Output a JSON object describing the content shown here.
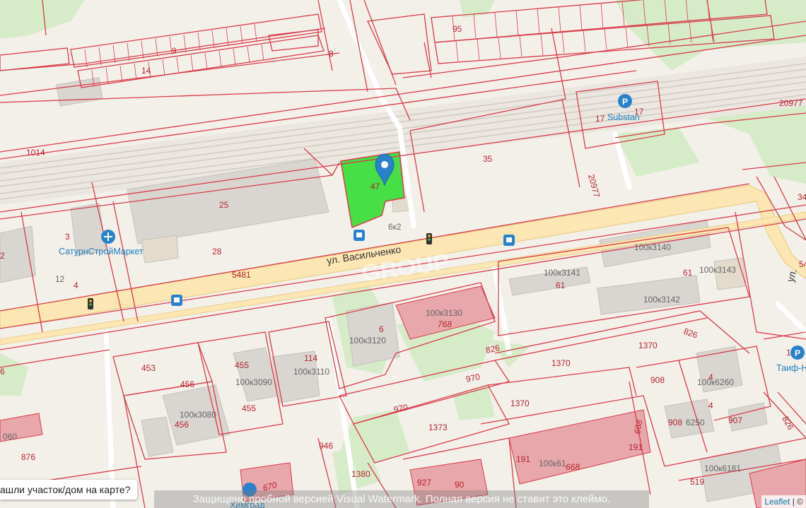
{
  "cadastral_numbers": {
    "n9": "9",
    "n14": "14",
    "n8": "8",
    "n95": "95",
    "n1014": "1014",
    "n20977": "20977",
    "n20977v": "20977",
    "n17a": "17",
    "n17b": "17",
    "n35": "35",
    "n47": "47",
    "n6k2": "6к2",
    "n25": "25",
    "n28": "28",
    "n3": "3",
    "n2": "2",
    "n12": "12",
    "n4": "4",
    "n5481": "5481",
    "n6": "6",
    "n768": "768",
    "n61a": "61",
    "n61b": "61",
    "n826a": "826",
    "n826b": "826",
    "n1370a": "1370",
    "n1370b": "1370",
    "n1370c": "1370",
    "n114": "114",
    "n453": "453",
    "n455a": "455",
    "n455b": "455",
    "n456a": "456",
    "n456b": "456",
    "n970a": "970",
    "n970b": "970",
    "n908a": "908",
    "n908b": "908",
    "n4a": "4",
    "n4b": "4",
    "n907": "907",
    "n1373": "1373",
    "n946": "946",
    "n876": "876",
    "n1380": "1380",
    "n927": "927",
    "n191a": "191",
    "n191b": "191",
    "n668a": "668",
    "n668b": "668",
    "n519": "519",
    "n670": "670",
    "n34": "34",
    "n54": "54",
    "n826c": "826",
    "n6e": "6",
    "n060": "060",
    "n1": "1",
    "n90": "90"
  },
  "building_numbers": {
    "b100x3140": "100к3140",
    "b100x3141": "100к3141",
    "b100x3143": "100к3143",
    "b100x3142": "100к3142",
    "b100x3130": "100к3130",
    "b100x3120": "100к3120",
    "b100x3110": "100к3110",
    "b100x3090": "100к3090",
    "b100x3080": "100к3080",
    "b100x6260": "100к6260",
    "b100x6250": "6250",
    "b100x6181": "100к6181",
    "b100x6170": "100к61"
  },
  "street": {
    "name": "ул. Васильченко",
    "edge_name": "ул."
  },
  "pois": {
    "saturn": "СатурнСтройМаркет",
    "substan": "Substan",
    "taif": "Таиф-Н",
    "himgrad": "Химград"
  },
  "watermark_text": "GROUP",
  "ask_box": {
    "text": "ашли участок/дом на карте?"
  },
  "trial_watermark": "Защищено пробной версией Visual Watermark. Полная версия не ставит это клеймо.",
  "attribution": {
    "link": "Leaflet",
    "sep": "| ©"
  },
  "colors": {
    "parcel_border": "#d93b48",
    "selected_parcel": "#22dd22",
    "marker": "#2a81cb"
  }
}
